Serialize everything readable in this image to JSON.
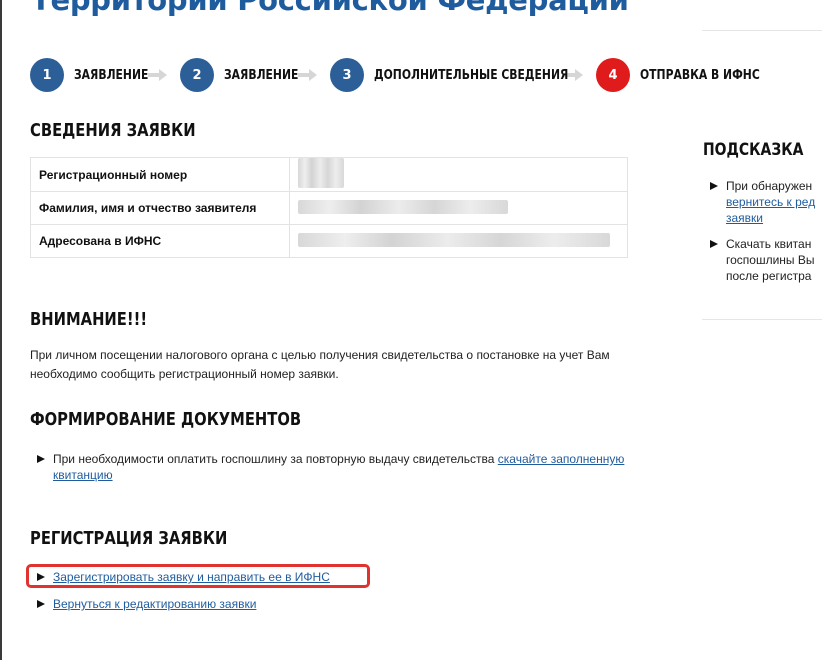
{
  "page": {
    "title": "Территории Российской Федерации"
  },
  "stepper": {
    "steps": [
      {
        "number": "1",
        "label": "ЗАЯВЛЕНИЕ",
        "active": false
      },
      {
        "number": "2",
        "label": "ЗАЯВЛЕНИЕ",
        "active": false
      },
      {
        "number": "3",
        "label": "ДОПОЛНИТЕЛЬНЫЕ СВЕДЕНИЯ",
        "active": false
      },
      {
        "number": "4",
        "label": "ОТПРАВКА В ИФНС",
        "active": true
      }
    ]
  },
  "application_info": {
    "title": "СВЕДЕНИЯ ЗАЯВКИ",
    "rows": [
      {
        "label": "Регистрационный номер",
        "value": ""
      },
      {
        "label": "Фамилия, имя и отчество заявителя",
        "value": ""
      },
      {
        "label": "Адресована в ИФНС",
        "value": ""
      }
    ]
  },
  "warning": {
    "title": "ВНИМАНИЕ!!!",
    "text": "При личном посещении налогового органа с целью получения свидетельства о постановке на учет Вам необходимо сообщить регистрационный номер заявки."
  },
  "documents": {
    "title": "ФОРМИРОВАНИЕ ДОКУМЕНТОВ",
    "item_text": "При необходимости оплатить госпошлину за повторную выдачу свидетельства ",
    "item_link": "скачайте заполненную квитанцию"
  },
  "registration": {
    "title": "РЕГИСТРАЦИЯ ЗАЯВКИ",
    "register_link": "Зарегистрировать заявку и направить ее в ИФНС",
    "back_link": "Вернуться к редактированию заявки"
  },
  "sidebar": {
    "title": "ПОДСКАЗКА",
    "hint1_text": "При обнаружен",
    "hint1_link_line1": "вернитесь к ред",
    "hint1_link_line2": "заявки",
    "hint2_line1": "Скачать квитан",
    "hint2_line2": "госпошлины Вы",
    "hint2_line3": "после регистра"
  },
  "colors": {
    "brand_blue": "#2c5f98",
    "title_blue": "#1f5c9e",
    "active_step_red": "#df1b1b",
    "highlight_red": "#e0322e"
  },
  "icons": {
    "step_arrow": "arrow-right-icon",
    "bullet": "chevron-right-icon"
  }
}
